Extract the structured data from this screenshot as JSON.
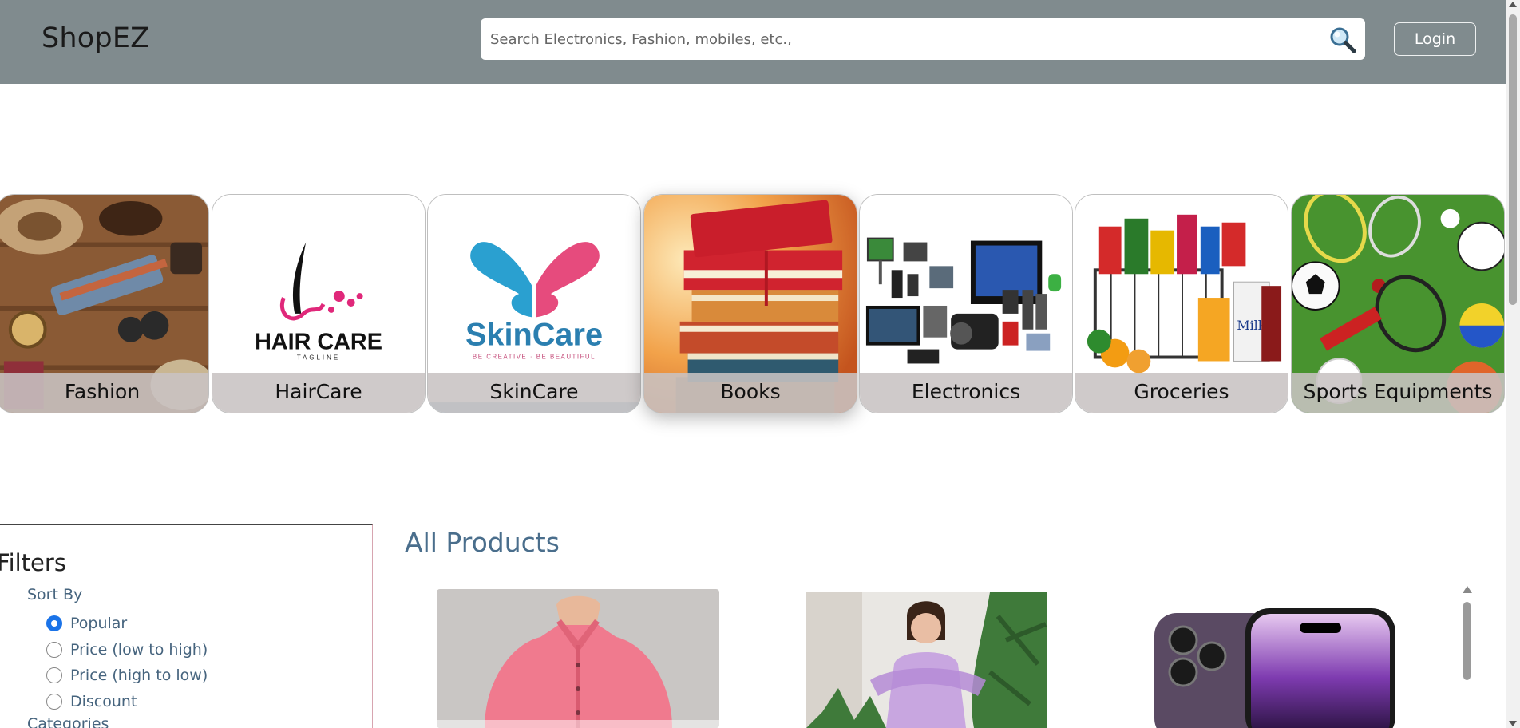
{
  "header": {
    "logo": "ShopEZ",
    "search_placeholder": "Search Electronics, Fashion, mobiles, etc.,",
    "search_icon": "search-icon",
    "login_label": "Login"
  },
  "categories": [
    {
      "label": "Fashion"
    },
    {
      "label": "HairCare",
      "logo_text": "HAIR CARE",
      "tagline": "TAGLINE"
    },
    {
      "label": "SkinCare",
      "logo_text": "SkinCare",
      "tagline": "BE CREATIVE · BE BEAUTIFUL"
    },
    {
      "label": "Books"
    },
    {
      "label": "Electronics"
    },
    {
      "label": "Groceries",
      "milk_text": "Milk"
    },
    {
      "label": "Sports Equipments"
    }
  ],
  "filters": {
    "title": "Filters",
    "sort_by": "Sort By",
    "sort_options": [
      {
        "label": "Popular",
        "checked": true
      },
      {
        "label": "Price (low to high)",
        "checked": false
      },
      {
        "label": "Price (high to low)",
        "checked": false
      },
      {
        "label": "Discount",
        "checked": false
      }
    ],
    "categories_title": "Categories"
  },
  "products": {
    "title": "All Products"
  }
}
